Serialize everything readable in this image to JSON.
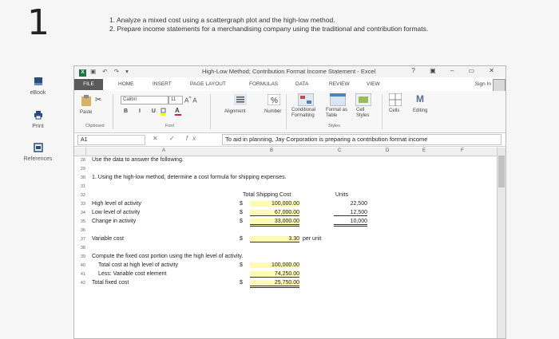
{
  "step_number": "1",
  "instructions": [
    "1. Analyze a mixed cost using a scattergraph plot and the high-low method.",
    "2. Prepare income statements for a merchandising company using the traditional and contribution formats."
  ],
  "left_nav": {
    "ebook": "eBook",
    "print": "Print",
    "references": "References"
  },
  "excel": {
    "window_title": "High-Low Method; Contribution Format Income Statement - Excel",
    "window_controls": "? ▣ – ▭ ✕",
    "tabs": [
      "FILE",
      "HOME",
      "INSERT",
      "PAGE LAYOUT",
      "FORMULAS",
      "DATA",
      "REVIEW",
      "VIEW"
    ],
    "sign_in": "Sign In",
    "ribbon": {
      "paste": "Paste",
      "clipboard": "Clipboard",
      "font_name": "Calibri",
      "font_size": "11",
      "font": "Font",
      "alignment": "Alignment",
      "number": "Number",
      "conditional_formatting": "Conditional Formatting",
      "format_as_table": "Format as Table",
      "cell_styles": "Cell Styles",
      "styles": "Styles",
      "cells": "Cells",
      "editing": "Editing"
    },
    "name_box": "A1",
    "formula": "To aid in planning, Jay Corporation is preparing a contribution format income",
    "columns": [
      "A",
      "B",
      "C",
      "D",
      "E",
      "F"
    ],
    "rows": {
      "r28": {
        "num": "28",
        "a": "Use the data to answer the following."
      },
      "r29": {
        "num": "29"
      },
      "r30": {
        "num": "30",
        "a": "1. Using the high-low method, determine a cost formula for shipping expenses."
      },
      "r31": {
        "num": "31"
      },
      "r32": {
        "num": "32",
        "b_header": "Total Shipping Cost",
        "c_header": "Units"
      },
      "r33": {
        "num": "33",
        "a": "High level of activity",
        "sym": "$",
        "b": "100,000.00",
        "c": "22,500"
      },
      "r34": {
        "num": "34",
        "a": "Low level of activity",
        "sym": "$",
        "b": "67,000.00",
        "c": "12,500"
      },
      "r35": {
        "num": "35",
        "a": "Change in activity",
        "sym": "$",
        "b": "33,000.00",
        "c": "10,000"
      },
      "r36": {
        "num": "36"
      },
      "r37": {
        "num": "37",
        "a": "Variable cost",
        "sym": "$",
        "b": "3.30",
        "c": "per unit"
      },
      "r38": {
        "num": "38"
      },
      "r39": {
        "num": "39",
        "a": "Compute the fixed cost portion using the high level of activity."
      },
      "r40": {
        "num": "40",
        "a": "Total cost at high level of activity",
        "sym": "$",
        "b": "100,000.00"
      },
      "r41": {
        "num": "41",
        "a": "Less: Variable cost element",
        "b": "74,250.00"
      },
      "r42": {
        "num": "42",
        "a": "Total fixed cost",
        "sym": "$",
        "b": "25,750.00"
      }
    }
  }
}
